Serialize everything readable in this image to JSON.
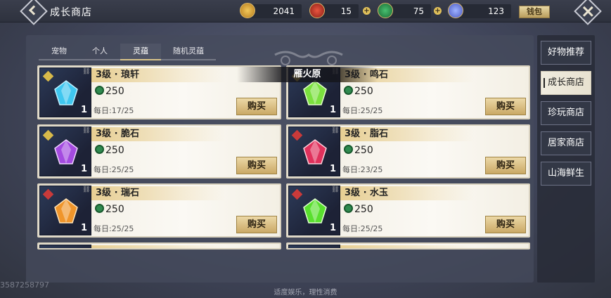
{
  "header": {
    "title": "成长商店",
    "currencies": [
      {
        "icon": "gold-pouch-icon",
        "value": "2041"
      },
      {
        "icon": "red-orb-icon",
        "value": "15"
      },
      {
        "icon": "green-coin-icon",
        "value": "75"
      },
      {
        "icon": "blue-crystal-icon",
        "value": "123"
      }
    ],
    "wallet_label": "钱包"
  },
  "tabs": [
    {
      "label": "宠物",
      "active": false
    },
    {
      "label": "个人",
      "active": false
    },
    {
      "label": "灵蕴",
      "active": true
    },
    {
      "label": "随机灵蕴",
      "active": false
    }
  ],
  "location_banner": "雁火原",
  "items": [
    {
      "name": "3级 · 琅轩",
      "price": "250",
      "daily": "每日:17/25",
      "qty": "1",
      "gem_color": "#3fc7f0",
      "badge_color": "#d8b94a",
      "buy_label": "购买"
    },
    {
      "name": "3级 · 鸣石",
      "price": "250",
      "daily": "每日:25/25",
      "qty": "1",
      "gem_color": "#7be03e",
      "badge_color": "#d8b94a",
      "buy_label": "购买"
    },
    {
      "name": "3级 · 脆石",
      "price": "250",
      "daily": "每日:25/25",
      "qty": "1",
      "gem_color": "#a44be0",
      "badge_color": "#d8b94a",
      "buy_label": "购买"
    },
    {
      "name": "3级 · 脂石",
      "price": "250",
      "daily": "每日:23/25",
      "qty": "1",
      "gem_color": "#e0315c",
      "badge_color": "#c93a3a",
      "buy_label": "购买"
    },
    {
      "name": "3级 · 瑞石",
      "price": "250",
      "daily": "每日:25/25",
      "qty": "1",
      "gem_color": "#f0952b",
      "badge_color": "#c93a3a",
      "buy_label": "购买"
    },
    {
      "name": "3级 · 水玉",
      "price": "250",
      "daily": "每日:25/25",
      "qty": "1",
      "gem_color": "#59e02e",
      "badge_color": "#c93a3a",
      "buy_label": "购买"
    }
  ],
  "sidebar": [
    {
      "label": "好物推荐",
      "active": false
    },
    {
      "label": "成长商店",
      "active": true
    },
    {
      "label": "珍玩商店",
      "active": false
    },
    {
      "label": "居家商店",
      "active": false
    },
    {
      "label": "山海鲜生",
      "active": false
    }
  ],
  "footer": "适度娱乐，理性消费",
  "uid_text": "3587258797"
}
